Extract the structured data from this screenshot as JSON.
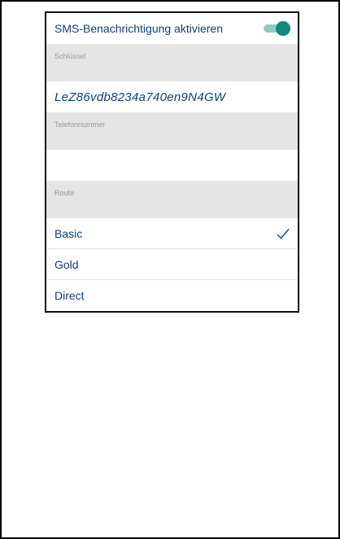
{
  "sms": {
    "label": "SMS-Benachrichtigung aktivieren",
    "enabled": true,
    "accent_color": "#10897a"
  },
  "key": {
    "section_label": "Schlüssel",
    "value": "LeZ86vdb8234a740en9N4GW"
  },
  "phone": {
    "section_label": "Telefonnummer",
    "value": ""
  },
  "route": {
    "section_label": "Route",
    "options": [
      {
        "label": "Basic",
        "selected": true
      },
      {
        "label": "Gold",
        "selected": false
      },
      {
        "label": "Direct",
        "selected": false
      }
    ],
    "selected_icon": "checkmark-icon"
  }
}
